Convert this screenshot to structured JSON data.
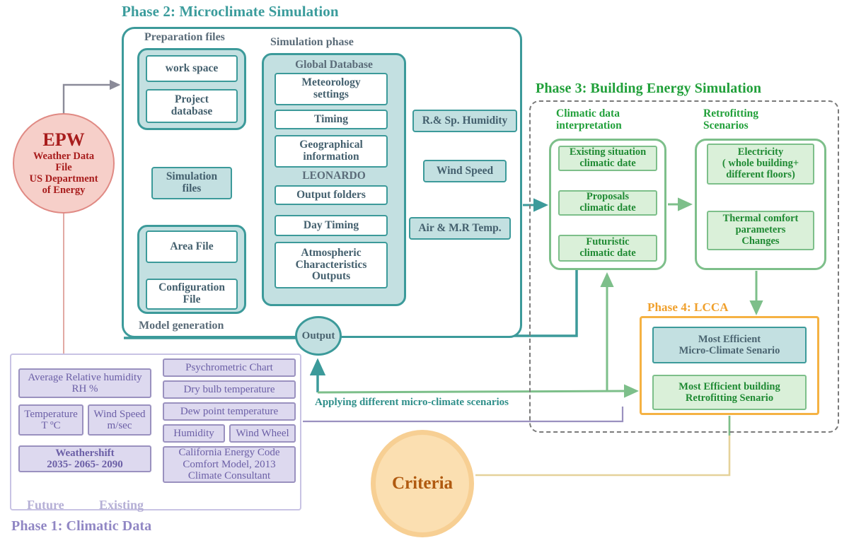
{
  "phases": {
    "phase1_title": "Phase 1: Climatic Data",
    "phase2_title": "Phase 2: Microclimate Simulation",
    "phase3_title": "Phase 3: Building Energy Simulation",
    "phase4_title": "Phase 4: LCCA"
  },
  "source": {
    "title": "EPW",
    "subtitle": "Weather Data\nFile\nUS Department\nof Energy"
  },
  "phase2": {
    "group_labels": {
      "preparation_files": "Preparation files",
      "simulation_phase": "Simulation phase",
      "model_generation": "Model generation",
      "global_database": "Global Database",
      "leonardo": "LEONARDO"
    },
    "preparation_items": [
      {
        "label": "work space"
      },
      {
        "label": "Project\ndatabase"
      }
    ],
    "simulation_files": "Simulation\nfiles",
    "model_items": [
      {
        "label": "Area File"
      },
      {
        "label": "Configuration\nFile"
      }
    ],
    "global_database_items": [
      {
        "label": "Meteorology\nsettings"
      },
      {
        "label": "Timing"
      },
      {
        "label": "Geographical\ninformation"
      }
    ],
    "leonardo_items": [
      {
        "label": "Output folders"
      },
      {
        "label": "Day Timing"
      },
      {
        "label": "Atmospheric\nCharacteristics\nOutputs"
      }
    ],
    "outputs": [
      {
        "label": "R.& Sp. Humidity"
      },
      {
        "label": "Wind Speed"
      },
      {
        "label": "Air & M.R Temp."
      }
    ],
    "output_node": "Output"
  },
  "phase1": {
    "left_items": [
      {
        "label": "Average Relative humidity\nRH %"
      },
      {
        "label": "Temperature\nT ºC"
      },
      {
        "label": "Wind Speed\nm/sec"
      },
      {
        "label": "Weathershift\n2035- 2065- 2090"
      }
    ],
    "right_items": [
      {
        "label": "Psychrometric Chart"
      },
      {
        "label": "Dry bulb temperature"
      },
      {
        "label": "Dew point temperature"
      },
      {
        "label": "Humidity"
      },
      {
        "label": "Wind Wheel"
      },
      {
        "label": "California Energy Code\nComfort Model, 2013\nClimate Consultant"
      }
    ],
    "branch_labels": {
      "future": "Future",
      "existing": "Existing"
    }
  },
  "phase3": {
    "group_labels": {
      "climatic_data_interpretation": "Climatic data\ninterpretation",
      "retrofitting_scenarios": "Retrofitting\nScenarios"
    },
    "climatic_items": [
      {
        "label": "Existing situation\nclimatic date"
      },
      {
        "label": "Proposals\nclimatic date"
      },
      {
        "label": "Futuristic\nclimatic date"
      }
    ],
    "retrofit_items": [
      {
        "label": "Electricity\n( whole building+\ndifferent floors)"
      },
      {
        "label": "Thermal comfort\nparameters\nChanges"
      }
    ]
  },
  "phase4": {
    "items": [
      {
        "label": "Most Efficient\nMicro-Climate Senario"
      },
      {
        "label": "Most Efficient building\nRetrofitting Senario"
      }
    ]
  },
  "criteria": {
    "label": "Criteria"
  },
  "annotations": {
    "apply_scenarios": "Applying different micro-climate scenarios"
  },
  "colors": {
    "teal": "#3c9a9a",
    "teal_fill": "#c3e0e1",
    "green": "#21a03a",
    "green_fill": "#daf0d9",
    "purple": "#6b5fa6",
    "purple_fill": "#ddd9ef",
    "orange": "#f5b243",
    "red": "#a81d1d",
    "red_fill": "#f6cfc9"
  }
}
